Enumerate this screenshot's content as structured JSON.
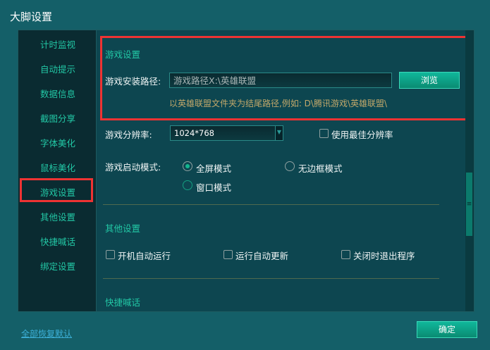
{
  "window": {
    "title": "大脚设置"
  },
  "sidebar": {
    "items": [
      {
        "label": "计时监视"
      },
      {
        "label": "自动提示"
      },
      {
        "label": "数据信息"
      },
      {
        "label": "截图分享"
      },
      {
        "label": "字体美化"
      },
      {
        "label": "鼠标美化"
      },
      {
        "label": "游戏设置"
      },
      {
        "label": "其他设置"
      },
      {
        "label": "快捷喊话"
      },
      {
        "label": "绑定设置"
      }
    ],
    "selected": "游戏设置"
  },
  "game": {
    "section_title": "游戏设置",
    "path_label": "游戏安装路径:",
    "path_value": "游戏路径X:\\英雄联盟",
    "browse_label": "浏览",
    "hint": "以英雄联盟文件夹为结尾路径,例如: D\\腾讯游戏\\英雄联盟\\",
    "resolution_label": "游戏分辨率:",
    "resolution_value": "1024*768",
    "best_res_label": "使用最佳分辨率",
    "best_res_checked": false,
    "mode_label": "游戏启动模式:",
    "modes": [
      {
        "label": "全屏模式",
        "selected": true
      },
      {
        "label": "无边框模式",
        "selected": false
      },
      {
        "label": "窗口模式",
        "selected": false
      }
    ]
  },
  "other": {
    "section_title": "其他设置",
    "options": [
      {
        "label": "开机自动运行",
        "checked": false
      },
      {
        "label": "运行自动更新",
        "checked": false
      },
      {
        "label": "关闭时退出程序",
        "checked": false
      }
    ]
  },
  "quick": {
    "section_title": "快捷喊话"
  },
  "footer": {
    "reset_label": "全部恢复默认",
    "ok_label": "确定"
  },
  "colors": {
    "highlight": "#ee3333",
    "accent": "#22c7a5"
  }
}
